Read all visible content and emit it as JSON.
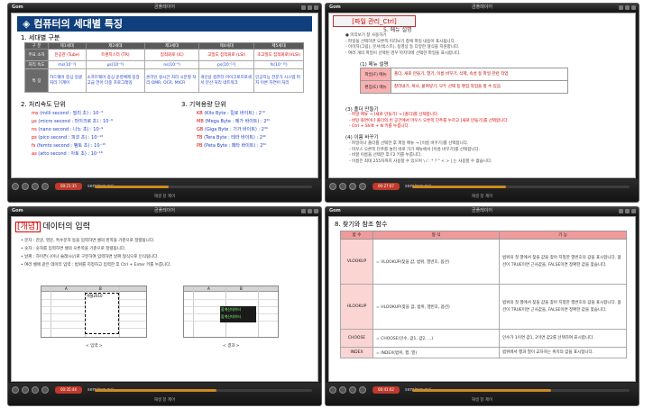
{
  "player": {
    "app_label": "Gom",
    "title": "곰플레이어",
    "subtitle": "재생 창 제어"
  },
  "panes": [
    {
      "filename": "seminar.avi",
      "time": "00:21:35",
      "progress": 0.34
    },
    {
      "filename": "seminar.avi",
      "time": "00:27:07",
      "progress": 0.43
    },
    {
      "filename": "seminar.avi",
      "time": "00:35:44",
      "progress": 0.56
    },
    {
      "filename": "seminar.avi",
      "time": "00:41:02",
      "progress": 0.64
    }
  ],
  "slide1": {
    "title": "◈ 컴퓨터의 세대별 특징",
    "section1": "1. 세대별 구분",
    "table": {
      "headers": [
        "구 분",
        "제1세대",
        "제2세대",
        "제3세대",
        "제4세대",
        "제5세대"
      ],
      "rows": [
        {
          "label": "주요 소자",
          "cells": [
            "진공관 (Tube)",
            "트랜지스터 (TR)",
            "집적회로 (IC)",
            "고밀도 집적회로 (LSI)",
            "초고밀도 집적회로(VLSI)"
          ]
        },
        {
          "label": "처리 속도",
          "cells": [
            "ms(10⁻³)",
            "μs(10⁻⁶)",
            "ns(10⁻⁹)",
            "ps(10⁻¹²)",
            "fs(10⁻¹⁵)"
          ]
        },
        {
          "label": "특 징",
          "cells": [
            "하드웨어 중심 일괄 처리 기계어",
            "소프트웨어 중심 운영체제 등장 고급 언어 다중 프로그래밍",
            "온라인 실시간 처리 시분할 처리 OMR, OCR, MICR",
            "개인용 컴퓨터 마이크로프로세서 분산 처리 네트워크",
            "인공지능 전문가 시스템 퍼지 이론 자연어 처리"
          ]
        }
      ]
    },
    "section2": "2. 처리속도 단위",
    "section3": "3. 기억용량 단위",
    "speed_units": [
      {
        "sym": "ms",
        "text": "(milli second : 밀리 초) : 10⁻³"
      },
      {
        "sym": "μs",
        "text": "(micro second : 마이크로 초) : 10⁻⁶"
      },
      {
        "sym": "ns",
        "text": "(nano second : 나노 초) : 10⁻⁹"
      },
      {
        "sym": "ps",
        "text": "(pico second : 피코 초) : 10⁻¹²"
      },
      {
        "sym": "fs",
        "text": "(femto second : 펨토 초) : 10⁻¹⁵"
      },
      {
        "sym": "as",
        "text": "(atto second : 아토 초) : 10⁻¹⁸"
      }
    ],
    "memory_units": [
      {
        "sym": "KB",
        "text": "(Kilo Byte : 킬로 바이트) : 2¹⁰"
      },
      {
        "sym": "MB",
        "text": "(Mega Byte : 메가 바이트) : 2²⁰"
      },
      {
        "sym": "GB",
        "text": "(Giga Byte : 기가 바이트) : 2³⁰"
      },
      {
        "sym": "TB",
        "text": "(Tera Byte : 테라 바이트) : 2⁴⁰"
      },
      {
        "sym": "PB",
        "text": "(Peta Byte : 페타 바이트) : 2⁵⁰"
      }
    ]
  },
  "slide2": {
    "title": "[파일 관리_Ctrl]",
    "subtitle": "5. 메뉴 설명",
    "intro": [
      "● 미리보기 창 사용하기",
      "  - 파일을 선택하면 오른쪽 미리보기 창에 파일 내용이 표시됩니다.",
      "  - 이미지(그림), 문서(텍스트), 동영상 등 다양한 형식을 지원합니다.",
      "  - 여러 개의 파일이 선택된 경우 마지막에 선택한 파일을 표시합니다."
    ],
    "heading_a": "(1) 메뉴 설명",
    "table_a": [
      {
        "k": "파일(F) 메뉴",
        "v": "폴더, 새로 만들기, 열기, 이름 바꾸기, 삭제, 속성 등 파일 관련 작업"
      },
      {
        "k": "편집(E) 메뉴",
        "v": "잘라내기, 복사, 붙여넣기, 모두 선택 등 편집 작업을 할 수 있음"
      }
    ],
    "heading_b": "(3) 폴더 만들기",
    "list_b": [
      "- 파일 메뉴 → [새로 만들기] → [폴더]를 선택합니다.",
      "- 바탕 화면이나 폴더의 빈 공간에서 마우스 오른쪽 단추를 누르고 [새로 만들기]를 선택합니다.",
      "- Ctrl + Shift + N 키를 누릅니다."
    ],
    "heading_c": "(4) 이름 바꾸기",
    "list_c": [
      "- 파일이나 폴더를 선택한 후 파일 메뉴 → [이름 바꾸기]를 선택합니다.",
      "- 마우스 오른쪽 단추를 눌러 바로 가기 메뉴에서 [이름 바꾸기]를 선택합니다.",
      "- 바꿀 이름을 선택한 후 F2 키를 누릅니다.",
      "- 이름은 최대 255자까지 사용할 수 있으며 \\ / : * ? \" < > | 는 사용할 수 없습니다."
    ]
  },
  "slide3": {
    "title_box": "[개념]",
    "title_rest": " 데이터의 입력",
    "bullets": [
      "• 문자 : 한글, 영문, 특수문자 등을 입력하면 셀의 왼쪽을 기준으로 정렬됩니다.",
      "• 숫자 : 숫자를 입력하면 셀의 오른쪽을 기준으로 정렬됩니다.",
      "• 날짜 : 하이픈(-)이나 슬래시(/)로 구분하여 입력하면 날짜 형식으로 인식됩니다.",
      "• 여러 셀에 같은 데이터 입력 : 범위를 지정하고 입력한 후 Ctrl + Enter 키를 누릅니다."
    ],
    "caption_left": "< 입력 >",
    "caption_right": "< 결과 >",
    "cell_text": "엑셀2010",
    "result_rows": [
      "합계산데이터",
      "합계산데이터"
    ],
    "col_a": "A",
    "col_b": "B"
  },
  "slide4": {
    "title": "8. 찾기와 참조 함수",
    "headers": [
      "함 수",
      "형 식",
      "기 능"
    ],
    "rows": [
      {
        "fn": "VLOOKUP",
        "fmt": "= VLOOKUP(찾을 값, 범위, 열번호, 옵션)",
        "desc": "범위의 첫 열에서 찾을 값을 찾아 지정한 열번호의 값을 표시합니다. 옵션이 TRUE이면 근사값을, FALSE이면 정확한 값을 찾습니다."
      },
      {
        "fn": "HLOOKUP",
        "fmt": "= HLOOKUP(찾을 값, 범위, 행번호, 옵션)",
        "desc": "범위의 첫 행에서 찾을 값을 찾아 지정한 행번호의 값을 표시합니다. 옵션이 TRUE이면 근사값을, FALSE이면 정확한 값을 찾습니다."
      },
      {
        "fn": "CHOOSE",
        "fmt": "= CHOOSE(인수, 값1, 값2, ...)",
        "desc": "인수가 1이면 값1, 2이면 값2를 선택하여 표시합니다."
      },
      {
        "fn": "INDEX",
        "fmt": "= INDEX(범위, 행, 열)",
        "desc": "범위에서 행과 열이 교차하는 위치의 값을 표시합니다."
      }
    ]
  }
}
